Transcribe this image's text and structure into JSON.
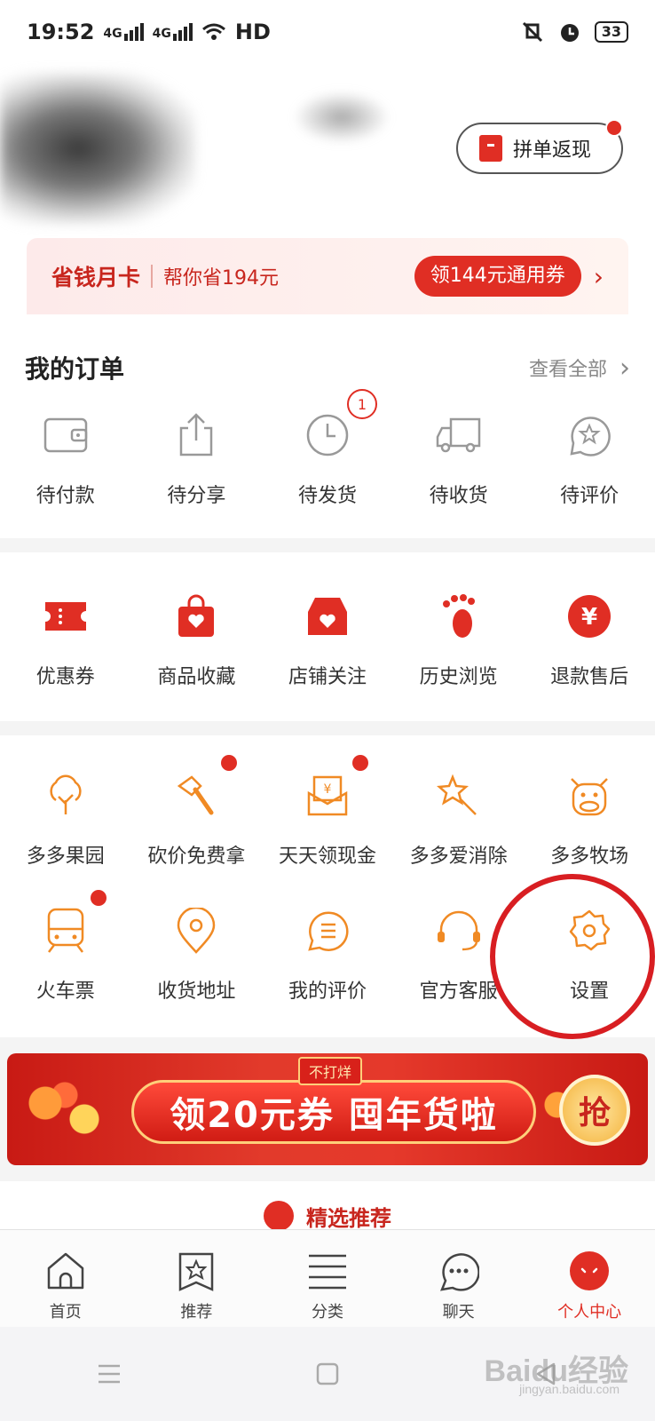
{
  "status_bar": {
    "time": "19:52",
    "net1": "4G",
    "net2": "4G",
    "hd": "HD",
    "battery": "33"
  },
  "header": {
    "rebate_label": "拼单返现"
  },
  "money_card": {
    "title": "省钱月卡",
    "subtitle": "帮你省194元",
    "cta": "领144元通用券"
  },
  "orders": {
    "title": "我的订单",
    "view_all": "查看全部",
    "items": [
      {
        "label": "待付款",
        "icon": "wallet-icon"
      },
      {
        "label": "待分享",
        "icon": "share-icon"
      },
      {
        "label": "待发货",
        "icon": "clock-icon",
        "badge": "1"
      },
      {
        "label": "待收货",
        "icon": "truck-icon"
      },
      {
        "label": "待评价",
        "icon": "star-bubble-icon"
      }
    ]
  },
  "tools": [
    {
      "label": "优惠券",
      "icon": "coupon-icon"
    },
    {
      "label": "商品收藏",
      "icon": "favorite-bag-icon"
    },
    {
      "label": "店铺关注",
      "icon": "store-heart-icon"
    },
    {
      "label": "历史浏览",
      "icon": "footprint-icon"
    },
    {
      "label": "退款售后",
      "icon": "yuan-icon"
    }
  ],
  "games": [
    {
      "label": "多多果园",
      "icon": "tree-icon"
    },
    {
      "label": "砍价免费拿",
      "icon": "axe-icon",
      "dot": true
    },
    {
      "label": "天天领现金",
      "icon": "cash-envelope-icon",
      "dot": true
    },
    {
      "label": "多多爱消除",
      "icon": "star-wand-icon"
    },
    {
      "label": "多多牧场",
      "icon": "cow-icon"
    },
    {
      "label": "火车票",
      "icon": "train-icon",
      "dot": true
    },
    {
      "label": "收货地址",
      "icon": "location-icon"
    },
    {
      "label": "我的评价",
      "icon": "comment-icon"
    },
    {
      "label": "官方客服",
      "icon": "headset-icon"
    },
    {
      "label": "设置",
      "icon": "gear-icon"
    }
  ],
  "banner": {
    "tag": "不打烊",
    "text": "领20元券 囤年货啦",
    "grab": "抢"
  },
  "recommend": {
    "title": "精选推荐"
  },
  "tabbar": [
    {
      "label": "首页",
      "icon": "home-icon"
    },
    {
      "label": "推荐",
      "icon": "recommend-icon"
    },
    {
      "label": "分类",
      "icon": "list-icon"
    },
    {
      "label": "聊天",
      "icon": "chat-icon"
    },
    {
      "label": "个人中心",
      "icon": "profile-icon",
      "active": true
    }
  ],
  "watermark": {
    "text": "Baidu经验",
    "sub": "jingyan.baidu.com"
  },
  "colors": {
    "brand": "#e02e24",
    "game_orange": "#f08a24",
    "highlight_circle": "#d81e22"
  }
}
